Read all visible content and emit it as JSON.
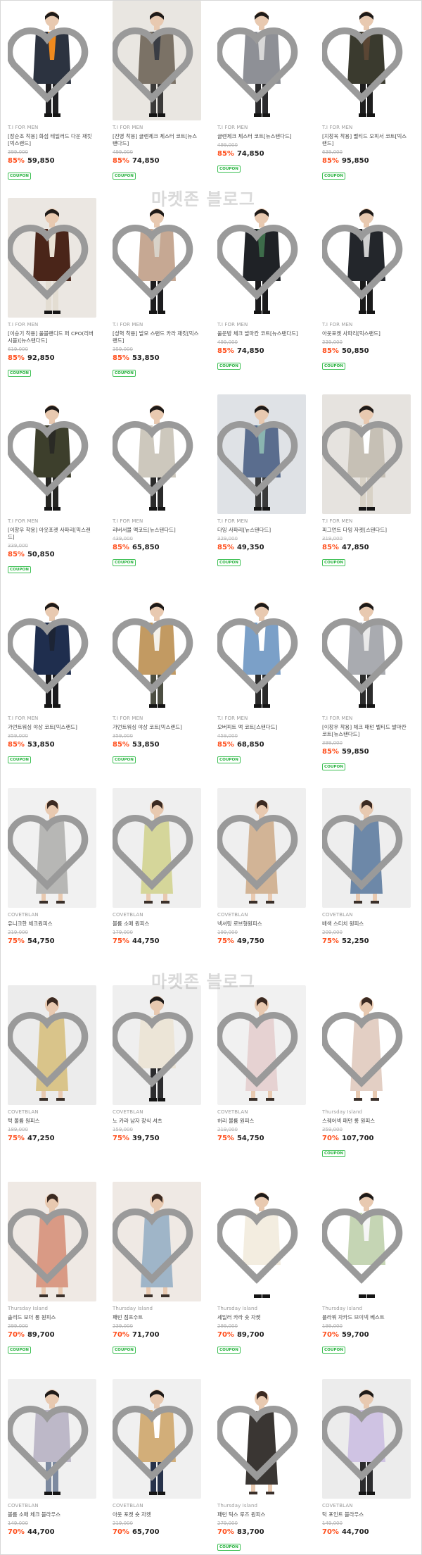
{
  "watermark": "마켓존 블로그",
  "coupon_label": "COUPON",
  "products": [
    {
      "brand": "T.I FOR MEN",
      "name": "[장순조 착용] 화섬 테일러드 다운 재킷[믹스랜드]",
      "orig": "399,000",
      "disc": "85%",
      "price": "59,850",
      "coupon": true,
      "bg": "#ffffff",
      "coat": "#2c3340",
      "inner": "#f08a1e",
      "pants": "#1f1f22"
    },
    {
      "brand": "T.I FOR MEN",
      "name": "[진영 착용] 글렌체크 체스터 코트[뉴스탠다드]",
      "orig": "499,000",
      "disc": "85%",
      "price": "74,850",
      "coupon": true,
      "bg": "#e9e6e1",
      "coat": "#7b7266",
      "inner": "#3a3d44",
      "pants": "#3b3a39"
    },
    {
      "brand": "T.I FOR MEN",
      "name": "글렌체크 체스터 코트[뉴스탠다드]",
      "orig": "499,000",
      "disc": "85%",
      "price": "74,850",
      "coupon": true,
      "bg": "#ffffff",
      "coat": "#8e9096",
      "inner": "#d8d8d8",
      "pants": "#2a2a2c"
    },
    {
      "brand": "T.I FOR MEN",
      "name": "[지창욱 착용] 벨티드 오피서 코트[믹스랜드]",
      "orig": "639,000",
      "disc": "85%",
      "price": "95,850",
      "coupon": true,
      "bg": "#ffffff",
      "coat": "#3a3a2e",
      "inner": "#5a4634",
      "pants": "#1e1e1e"
    },
    {
      "brand": "T.I FOR MEN",
      "name": "[이승기 착용] 울블랜디드 퍼 CPO(리버시블)[뉴스탠다드]",
      "orig": "619,000",
      "disc": "85%",
      "price": "92,850",
      "coupon": true,
      "bg": "#ebe7e2",
      "coat": "#4a2519",
      "inner": "#e9e2d5",
      "pants": "#e3ddd2"
    },
    {
      "brand": "T.I FOR MEN",
      "name": "[성혁 착용] 발모 스탠드 카라 재킷[믹스랜드]",
      "orig": "359,000",
      "disc": "85%",
      "price": "53,850",
      "coupon": true,
      "bg": "#ffffff",
      "coat": "#c6a893",
      "inner": "#d8d2c8",
      "pants": "#1d1d1f"
    },
    {
      "brand": "T.I FOR MEN",
      "name": "울운방 체크 발마칸 코트[뉴스탠다드]",
      "orig": "499,000",
      "disc": "85%",
      "price": "74,850",
      "coupon": true,
      "bg": "#ffffff",
      "coat": "#1f2226",
      "inner": "#3d6c4a",
      "pants": "#1b1b1d"
    },
    {
      "brand": "T.I FOR MEN",
      "name": "아웃포켓 사파리[믹스랜드]",
      "orig": "339,000",
      "disc": "85%",
      "price": "50,850",
      "coupon": true,
      "bg": "#ffffff",
      "coat": "#23262b",
      "inner": "#cfcfcf",
      "pants": "#1b1b1b"
    },
    {
      "brand": "T.I FOR MEN",
      "name": "[이창우 착용] 아웃포켓 사파리[믹스랜드]",
      "orig": "339,000",
      "disc": "85%",
      "price": "50,850",
      "coupon": true,
      "bg": "#ffffff",
      "coat": "#3d3f2c",
      "inner": "#2a2a25",
      "pants": "#262623"
    },
    {
      "brand": "T.I FOR MEN",
      "name": "리버서블 맥코트[뉴스탠다드]",
      "orig": "439,000",
      "disc": "85%",
      "price": "65,850",
      "coupon": true,
      "bg": "#ffffff",
      "coat": "#cdc8bd",
      "inner": "#ffffff",
      "pants": "#2a2a2a"
    },
    {
      "brand": "T.I FOR MEN",
      "name": "다잉 사파리[뉴스탠다드]",
      "orig": "329,000",
      "disc": "85%",
      "price": "49,350",
      "coupon": true,
      "bg": "#dfe2e6",
      "coat": "#5a6d8e",
      "inner": "#8ab5b0",
      "pants": "#3a3a3a"
    },
    {
      "brand": "T.I FOR MEN",
      "name": "피그먼트 다잉 자켓[스탠다드]",
      "orig": "319,000",
      "disc": "85%",
      "price": "47,850",
      "coupon": true,
      "bg": "#e6e3df",
      "coat": "#c6c0b5",
      "inner": "#ffffff",
      "pants": "#d8d2c6"
    },
    {
      "brand": "T.I FOR MEN",
      "name": "가먼트워싱 야상 코트[믹스랜드]",
      "orig": "359,000",
      "disc": "85%",
      "price": "53,850",
      "coupon": true,
      "bg": "#ffffff",
      "coat": "#1f2e4e",
      "inner": "#1c2435",
      "pants": "#1a1a1d"
    },
    {
      "brand": "T.I FOR MEN",
      "name": "가먼트워싱 야상 코트[믹스랜드]",
      "orig": "359,000",
      "disc": "85%",
      "price": "53,850",
      "coupon": true,
      "bg": "#ffffff",
      "coat": "#c29a62",
      "inner": "#f4f1ea",
      "pants": "#4c4e42"
    },
    {
      "brand": "T.I FOR MEN",
      "name": "오버피트 맥 코트[스탠다드]",
      "orig": "459,000",
      "disc": "85%",
      "price": "68,850",
      "coupon": true,
      "bg": "#ffffff",
      "coat": "#7ba0c8",
      "inner": "#ffffff",
      "pants": "#2a2a2a"
    },
    {
      "brand": "T.I FOR MEN",
      "name": "[이창우 착용] 체크 패턴 벨티드 발마칸 코트[뉴스탠다드]",
      "orig": "399,000",
      "disc": "85%",
      "price": "59,850",
      "coupon": true,
      "bg": "#ffffff",
      "coat": "#a9abb0",
      "inner": "#e9e9e9",
      "pants": "#2c2c2c"
    },
    {
      "brand": "COVETBLAN",
      "name": "유니크한 체크원피스",
      "orig": "219,000",
      "disc": "75%",
      "price": "54,750",
      "coupon": false,
      "bg": "#f1f1f1",
      "coat": "#b7b7b5",
      "inner": "#b7b7b5",
      "pants": "#b7b7b5"
    },
    {
      "brand": "COVETBLAN",
      "name": "볼륨 소매 원피스",
      "orig": "179,000",
      "disc": "75%",
      "price": "44,750",
      "coupon": false,
      "bg": "#efefef",
      "coat": "#d5d69a",
      "inner": "#d5d69a",
      "pants": "#d5d69a"
    },
    {
      "brand": "COVETBLAN",
      "name": "넥셔링 로브형원피스",
      "orig": "199,000",
      "disc": "75%",
      "price": "49,750",
      "coupon": false,
      "bg": "#efefef",
      "coat": "#d2b496",
      "inner": "#d2b496",
      "pants": "#d2b496"
    },
    {
      "brand": "COVETBLAN",
      "name": "배색 스티치 원피스",
      "orig": "209,000",
      "disc": "75%",
      "price": "52,250",
      "coupon": false,
      "bg": "#eeeeee",
      "coat": "#6d88a8",
      "inner": "#6d88a8",
      "pants": "#6d88a8"
    },
    {
      "brand": "COVETBLAN",
      "name": "턱 볼륨 원피스",
      "orig": "189,000",
      "disc": "75%",
      "price": "47,250",
      "coupon": false,
      "bg": "#ececec",
      "coat": "#d9c48a",
      "inner": "#d9c48a",
      "pants": "#d9c48a"
    },
    {
      "brand": "COVETBLAN",
      "name": "노 카라 남자 장식 셔츠",
      "orig": "159,000",
      "disc": "75%",
      "price": "39,750",
      "coupon": false,
      "bg": "#efefef",
      "coat": "#ece5d7",
      "inner": "#ece5d7",
      "pants": "#2c2c2e"
    },
    {
      "brand": "COVETBLAN",
      "name": "허리 볼륨 원피스",
      "orig": "219,000",
      "disc": "75%",
      "price": "54,750",
      "coupon": false,
      "bg": "#f1f1f1",
      "coat": "#e6d2d2",
      "inner": "#e6d2d2",
      "pants": "#e6d2d2"
    },
    {
      "brand": "Thursday Island",
      "name": "스퀘어넥 패턴 롱 원피스",
      "orig": "359,000",
      "disc": "70%",
      "price": "107,700",
      "coupon": true,
      "bg": "#ffffff",
      "coat": "#e3cfc4",
      "inner": "#e3cfc4",
      "pants": "#e3cfc4"
    },
    {
      "brand": "Thursday Island",
      "name": "솔리드 보더 롱 원피스",
      "orig": "299,000",
      "disc": "70%",
      "price": "89,700",
      "coupon": true,
      "bg": "#efe9e4",
      "coat": "#d99a85",
      "inner": "#d99a85",
      "pants": "#d99a85"
    },
    {
      "brand": "Thursday Island",
      "name": "패턴 점프수트",
      "orig": "239,000",
      "disc": "70%",
      "price": "71,700",
      "coupon": true,
      "bg": "#efe9e4",
      "coat": "#9fb5c8",
      "inner": "#9fb5c8",
      "pants": "#9fb5c8"
    },
    {
      "brand": "Thursday Island",
      "name": "세일러 카라 숏 자켓",
      "orig": "299,000",
      "disc": "70%",
      "price": "89,700",
      "coupon": true,
      "bg": "#ffffff",
      "coat": "#f3ede0",
      "inner": "#f3ede0",
      "pants": "#ffffff"
    },
    {
      "brand": "Thursday Island",
      "name": "플라워 자카드 브이넥 베스트",
      "orig": "199,000",
      "disc": "70%",
      "price": "59,700",
      "coupon": true,
      "bg": "#ffffff",
      "coat": "#c5d5b4",
      "inner": "#f5f5f5",
      "pants": "#ffffff"
    },
    {
      "brand": "COVETBLAN",
      "name": "볼륨 소매 체크 블라우스",
      "orig": "149,000",
      "disc": "70%",
      "price": "44,700",
      "coupon": false,
      "bg": "#f0f0f0",
      "coat": "#bdb8c8",
      "inner": "#bdb8c8",
      "pants": "#7d8aa0"
    },
    {
      "brand": "COVETBLAN",
      "name": "아웃 포켓 숏 자켓",
      "orig": "219,000",
      "disc": "70%",
      "price": "65,700",
      "coupon": false,
      "bg": "#f0f0f0",
      "coat": "#d2ae79",
      "inner": "#ffffff",
      "pants": "#27324a"
    },
    {
      "brand": "Thursday Island",
      "name": "패턴 틱스 루즈 원피스",
      "orig": "279,000",
      "disc": "70%",
      "price": "83,700",
      "coupon": true,
      "bg": "#ffffff",
      "coat": "#3a3633",
      "inner": "#3a3633",
      "pants": "#3a3633"
    },
    {
      "brand": "COVETBLAN",
      "name": "턱 포인트 블라우스",
      "orig": "149,000",
      "disc": "70%",
      "price": "44,700",
      "coupon": false,
      "bg": "#ececec",
      "coat": "#cfc3e3",
      "inner": "#cfc3e3",
      "pants": "#2c2c2e"
    }
  ]
}
